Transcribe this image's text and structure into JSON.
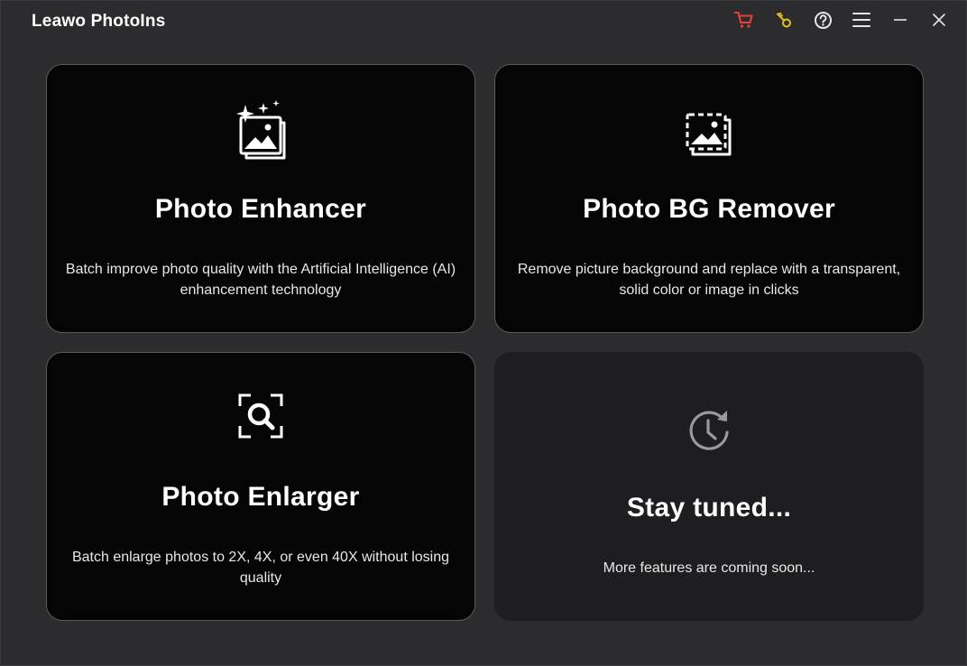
{
  "app": {
    "title": "Leawo PhotoIns"
  },
  "titlebar": {
    "icons": [
      {
        "name": "cart-icon",
        "color": "#e8423a"
      },
      {
        "name": "key-icon",
        "color": "#e8c21a"
      },
      {
        "name": "help-icon",
        "color": "#e6e6e6"
      },
      {
        "name": "menu-icon",
        "color": "#e6e6e6"
      },
      {
        "name": "minimize-icon",
        "color": "#e6e6e6"
      },
      {
        "name": "close-icon",
        "color": "#e6e6e6"
      }
    ]
  },
  "cards": {
    "enhancer": {
      "title": "Photo Enhancer",
      "desc_line1": "Batch improve photo quality with the Artificial Intelligence (AI)",
      "desc_line2": "enhancement technology",
      "icon": "sparkle-photo-icon"
    },
    "bg_remover": {
      "title": "Photo BG Remover",
      "desc_line1": "Remove picture background and replace with a transparent,",
      "desc_line2": "solid color or image in clicks",
      "icon": "dashed-photo-icon"
    },
    "enlarger": {
      "title": "Photo Enlarger",
      "desc_line1": "Batch enlarge photos to 2X, 4X, or even 40X without losing",
      "desc_line2": "quality",
      "icon": "magnifier-frame-icon"
    },
    "coming_soon": {
      "title": "Stay tuned...",
      "desc_line1": "More features are coming soon...",
      "icon": "clock-refresh-icon"
    }
  },
  "colors": {
    "background": "#2c2c2f",
    "card": "#050505",
    "card_disabled": "#1e1e20",
    "cart": "#e8423a",
    "key": "#e8c21a"
  }
}
